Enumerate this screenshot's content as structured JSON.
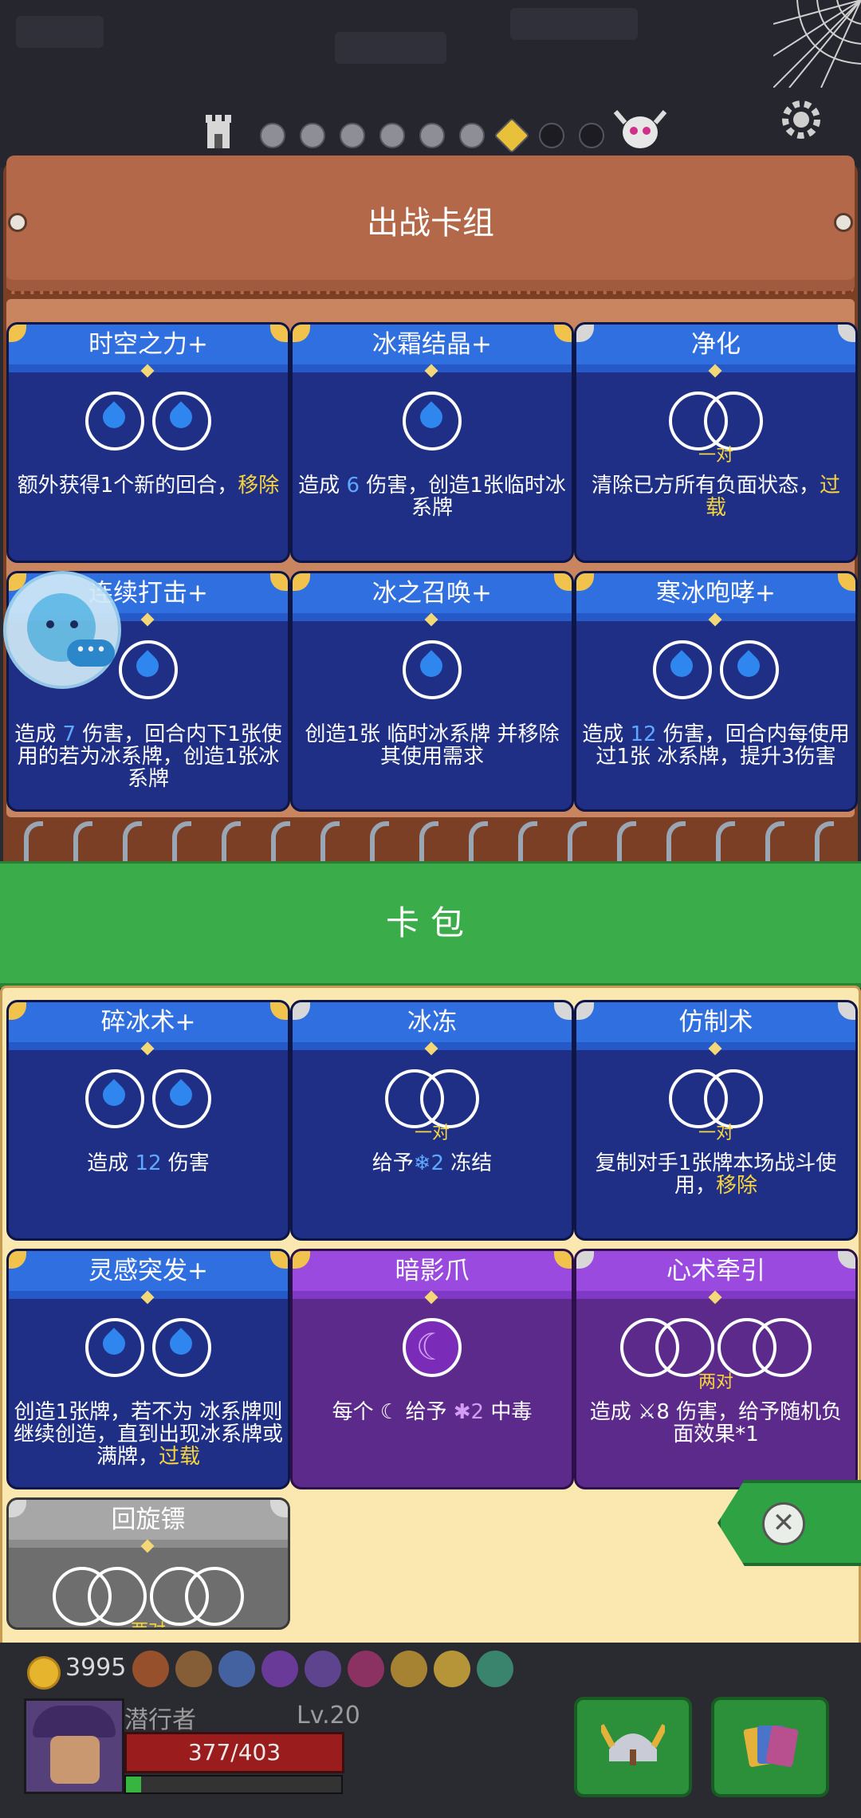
{
  "deck": {
    "title": "出战卡组",
    "cards": [
      {
        "name": "时空之力+",
        "desc": [
          {
            "t": "额外获得1个新的回合，"
          },
          {
            "t": "移除",
            "c": "y"
          }
        ],
        "cost": "drops2"
      },
      {
        "name": "冰霜结晶+",
        "desc": [
          {
            "t": "造成 "
          },
          {
            "t": "6",
            "c": "b"
          },
          {
            "t": " 伤害，创造1张临时"
          },
          {
            "t": "冰系牌"
          }
        ],
        "cost": "drops1"
      },
      {
        "name": "净化",
        "cost_label": "一对",
        "desc": [
          {
            "t": "清除已方所有负面状态，"
          },
          {
            "t": "过载",
            "c": "y"
          }
        ],
        "cost": "pair1"
      },
      {
        "name": "连续打击+",
        "desc": [
          {
            "t": "造成 "
          },
          {
            "t": "7",
            "c": "b"
          },
          {
            "t": " 伤害，回合内下1张使用的若为"
          },
          {
            "t": "冰系牌，创造1张冰系牌"
          }
        ],
        "cost": "drops1"
      },
      {
        "name": "冰之召唤+",
        "desc": [
          {
            "t": "创造1张 临时"
          },
          {
            "t": "冰系牌 并移除其使用需求"
          }
        ],
        "cost": "drops1"
      },
      {
        "name": "寒冰咆哮+",
        "desc": [
          {
            "t": "造成 "
          },
          {
            "t": "12",
            "c": "b"
          },
          {
            "t": " 伤害，回合内每使用过1张 "
          },
          {
            "t": "冰系牌，提升3伤害"
          }
        ],
        "cost": "drops2"
      }
    ]
  },
  "pack": {
    "title": "卡包",
    "cards": [
      {
        "name": "碎冰术+",
        "desc": [
          {
            "t": "造成 "
          },
          {
            "t": "12",
            "c": "b"
          },
          {
            "t": " 伤害"
          }
        ],
        "cost": "drops2"
      },
      {
        "name": "冰冻",
        "cost_label": "一对",
        "desc": [
          {
            "t": "给予"
          },
          {
            "t": "❄2",
            "c": "b"
          },
          {
            "t": " 冻结"
          }
        ],
        "cost": "pair1"
      },
      {
        "name": "仿制术",
        "cost_label": "一对",
        "desc": [
          {
            "t": "复制对手1张牌本场战斗使用，"
          },
          {
            "t": "移除",
            "c": "y"
          }
        ],
        "cost": "pair1"
      },
      {
        "name": "灵感突发+",
        "desc": [
          {
            "t": "创造1张牌，若不为 "
          },
          {
            "t": "冰系牌则继续创造，直到出现冰系牌或满牌，"
          },
          {
            "t": "过载",
            "c": "y"
          }
        ],
        "cost": "drops2"
      },
      {
        "name": "暗影爪",
        "desc": [
          {
            "t": "每个 ☾ 给予 "
          },
          {
            "t": "✱2",
            "c": "p"
          },
          {
            "t": " 中毒"
          }
        ],
        "cost": "moon"
      },
      {
        "name": "心术牵引",
        "cost_label": "两对",
        "desc": [
          {
            "t": "造成 ⚔8 伤害，给予随机负面效果*1"
          }
        ],
        "cost": "pair2"
      },
      {
        "name": "回旋镖",
        "cost_label": "两对",
        "desc": [],
        "cost": "pair2"
      }
    ]
  },
  "hud": {
    "gold": "3995",
    "player_name": "潜行者",
    "level": "Lv.20",
    "hp": "377/403",
    "xp_fraction": 0.07
  },
  "icons": {
    "close": "close-icon",
    "settings": "gear-icon",
    "coin": "coin-icon"
  },
  "colors": {
    "ice_card": "#1f2f86",
    "shadow_card": "#5b2a8a",
    "pack_header": "#3bac4a",
    "deck_header": "#b4684a",
    "highlight": "#f7d53b"
  }
}
